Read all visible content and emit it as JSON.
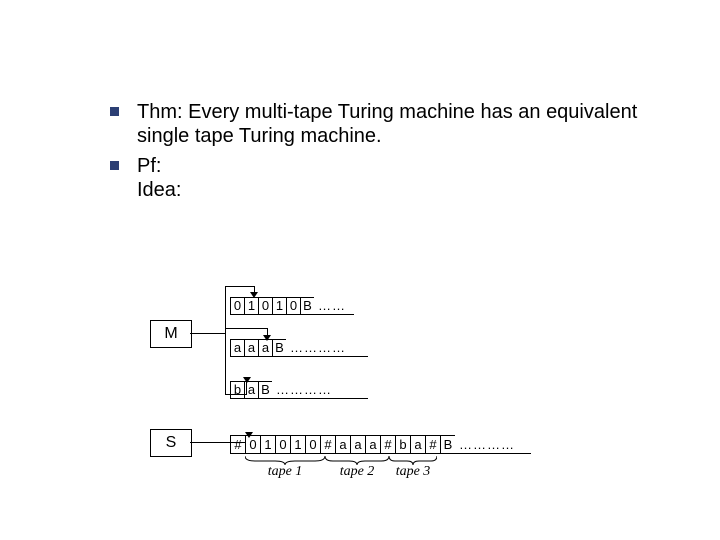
{
  "bullets": [
    {
      "marker": "square",
      "text": "Thm: Every multi-tape Turing machine has an equivalent single tape Turing machine."
    },
    {
      "marker": "square",
      "text_line1": "Pf:",
      "text_line2": "Idea:"
    }
  ],
  "machines": {
    "multi_label": "M",
    "single_label": "S"
  },
  "tape1": {
    "cells": [
      "0",
      "1",
      "0",
      "1",
      "0",
      "B"
    ],
    "trail": "……",
    "head_index": 1
  },
  "tape2": {
    "cells": [
      "a",
      "a",
      "a",
      "B"
    ],
    "trail": "…………",
    "head_index": 2
  },
  "tape3": {
    "cells": [
      "b",
      "a",
      "B"
    ],
    "trail": "…………",
    "head_index": 0
  },
  "single_tape": {
    "cells": [
      "#",
      "0",
      "1",
      "0",
      "1",
      "0",
      "#",
      "a",
      "a",
      "a",
      "#",
      "b",
      "a",
      "#",
      "B"
    ],
    "trail": "…………"
  },
  "brace_labels": {
    "b1": "tape 1",
    "b2": "tape 2",
    "b3": "tape 3"
  }
}
